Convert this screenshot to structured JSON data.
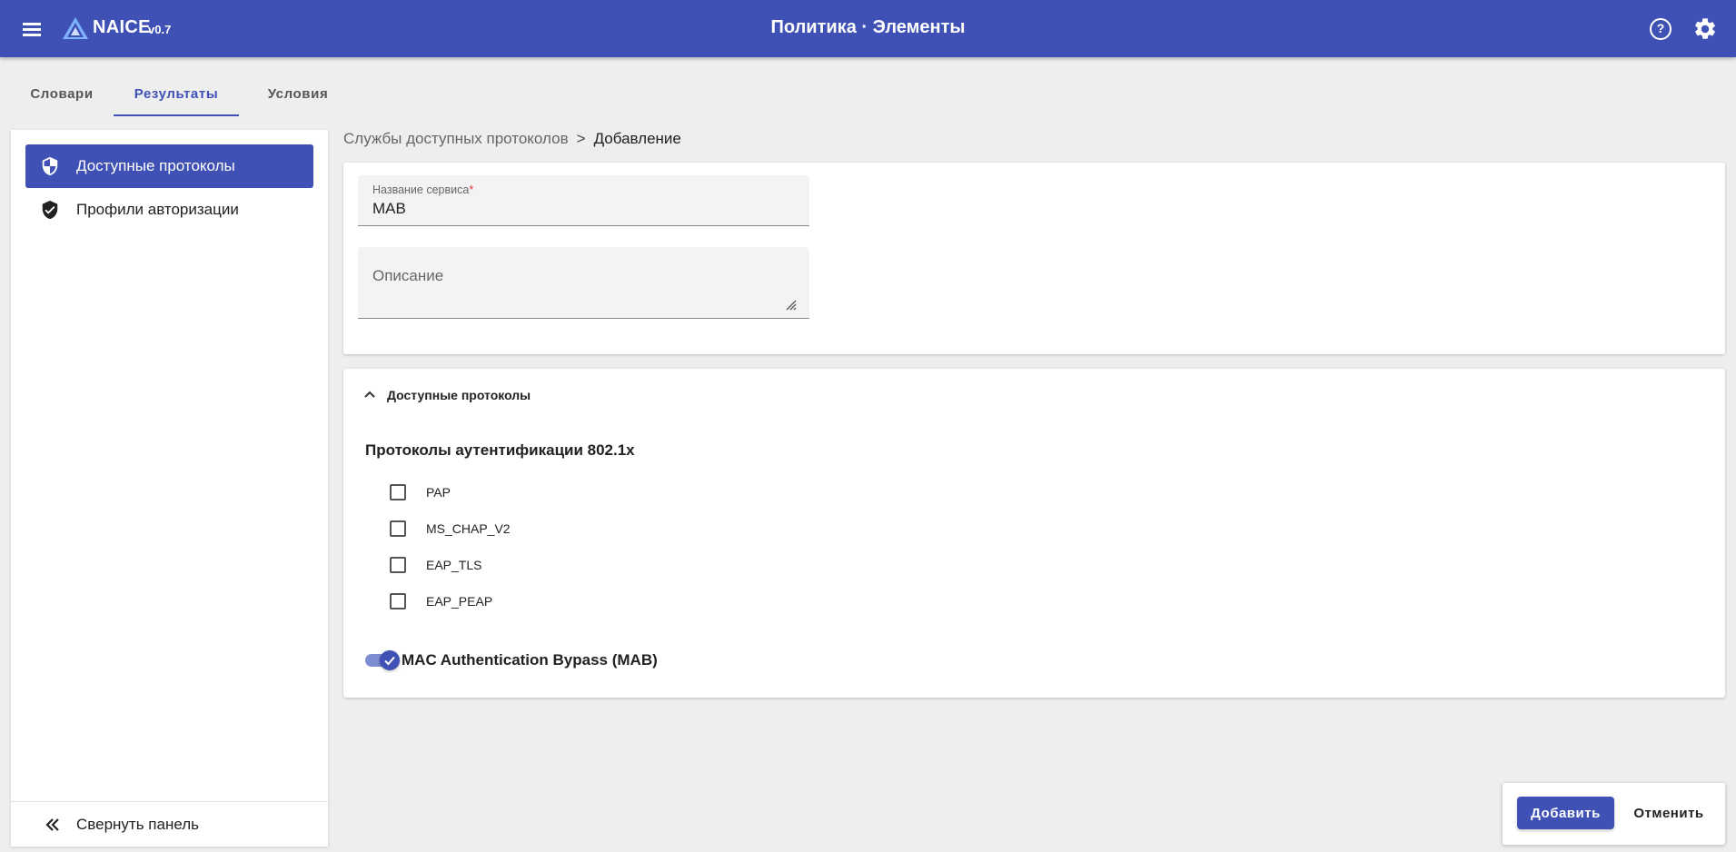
{
  "header": {
    "brand": "NAICE",
    "version": "v0.7",
    "title": "Политика · Элементы",
    "bg_color": "#3f51b5"
  },
  "tabs": [
    {
      "label": "Словари",
      "active": false
    },
    {
      "label": "Результаты",
      "active": true
    },
    {
      "label": "Условия",
      "active": false
    }
  ],
  "sidebar": {
    "items": [
      {
        "label": "Доступные протоколы",
        "icon": "shield-icon",
        "active": true
      },
      {
        "label": "Профили авторизации",
        "icon": "verified-shield-icon",
        "active": false
      }
    ],
    "collapse_label": "Свернуть панель"
  },
  "breadcrumb": {
    "parent": "Службы доступных протоколов",
    "separator": ">",
    "current": "Добавление"
  },
  "form": {
    "service_name": {
      "label": "Название сервиса",
      "required_mark": "*",
      "value": "MAB"
    },
    "description": {
      "placeholder": "Описание",
      "value": ""
    }
  },
  "protocols": {
    "header": "Доступные протоколы",
    "expanded": true,
    "section_title": "Протоколы аутентификации 802.1x",
    "options": [
      {
        "label": "PAP",
        "checked": false
      },
      {
        "label": "MS_CHAP_V2",
        "checked": false
      },
      {
        "label": "EAP_TLS",
        "checked": false
      },
      {
        "label": "EAP_PEAP",
        "checked": false
      }
    ],
    "mab_toggle": {
      "label": "MAC Authentication Bypass (MAB)",
      "enabled": true
    }
  },
  "actions": {
    "add_label": "Добавить",
    "cancel_label": "Отменить"
  }
}
